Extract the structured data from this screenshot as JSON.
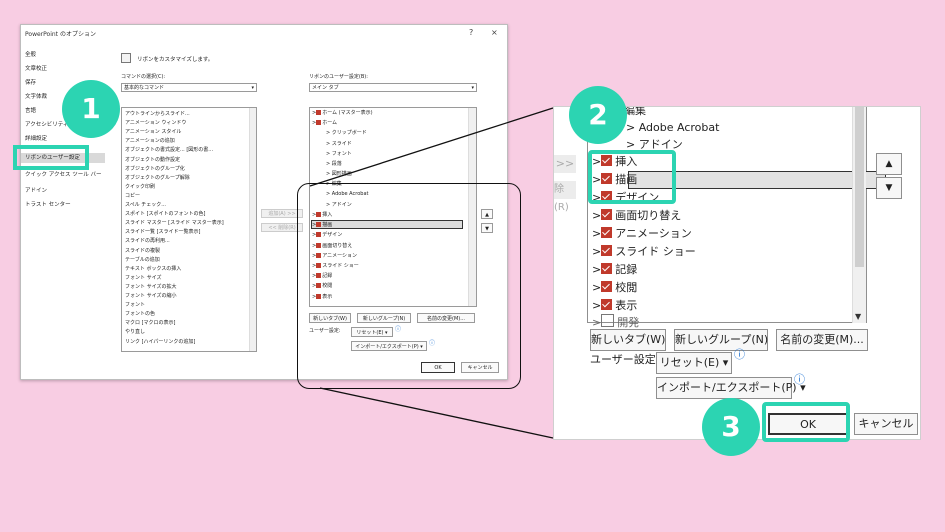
{
  "dialog": {
    "title": "PowerPoint のオプション",
    "help": "?",
    "close": "×",
    "nav": [
      "全般",
      "文章校正",
      "保存",
      "文字体裁",
      "言語",
      "アクセシビリティ",
      "詳細設定",
      "リボンのユーザー設定",
      "クイック アクセス ツール バー",
      "アドイン",
      "トラスト センター"
    ],
    "heading": "リボンをカスタマイズします。",
    "cmd_choose_label": "コマンドの選択(C):",
    "cmd_choose_value": "基本的なコマンド",
    "ribbon_label": "リボンのユーザー設定(B):",
    "ribbon_value": "メイン タブ",
    "commands": [
      "アウトラインからスライド...",
      "アニメーション ウィンドウ",
      "アニメーション スタイル",
      "アニメーションの追加",
      "オブジェクトの書式設定... [図形の書...",
      "オブジェクトの動作設定",
      "オブジェクトのグループ化",
      "オブジェクトのグループ解除",
      "クイック印刷",
      "コピー",
      "スペル チェック...",
      "スポイト [スポイトのフォントの色]",
      "スライド マスター [スライド マスター表示]",
      "スライド一覧 [スライド一覧表示]",
      "スライドの再利用...",
      "スライドの複製",
      "テーブルの追加",
      "テキスト ボックスの挿入",
      "フォント サイズ",
      "フォント サイズの拡大",
      "フォント サイズの縮小",
      "フォント",
      "フォントの色",
      "マクロ [マクロの表示]",
      "やり直し",
      "リンク [ハイパーリンクの追加]"
    ],
    "tabs": [
      "ホーム (マスター表示)",
      "ホーム",
      "クリップボード",
      "スライド",
      "フォント",
      "段落",
      "図形描画",
      "編集",
      "Adobe Acrobat",
      "アドイン",
      "挿入",
      "描画",
      "デザイン",
      "画面切り替え",
      "アニメーション",
      "スライド ショー",
      "記録",
      "校閲",
      "表示"
    ],
    "add_btn": "追加(A) >>",
    "remove_btn": "<< 削除(R)",
    "new_tab": "新しいタブ(W)",
    "new_group": "新しいグループ(N)",
    "rename": "名前の変更(M)...",
    "user_settings": "ユーザー設定:",
    "reset": "リセット(E) ▾",
    "import_export": "インポート/エクスポート(P) ▾",
    "ok": "OK",
    "cancel": "キャンセル"
  },
  "zoom": {
    "partial_top": "編集",
    "acrobat": "Adobe Acrobat",
    "addin": "アドイン",
    "tabs": [
      "挿入",
      "描画",
      "デザイン",
      "画面切り替え",
      "アニメーション",
      "スライド ショー",
      "記録",
      "校閲",
      "表示"
    ],
    "partial_bottom": "開発",
    "add_partial": ">>",
    "remove_partial": "除(R)",
    "new_tab": "新しいタブ(W)",
    "new_group": "新しいグループ(N)",
    "rename": "名前の変更(M)...",
    "user_settings": "ユーザー設定:",
    "reset": "リセット(E) ▾",
    "import_export": "インポート/エクスポート(P) ▾",
    "ok": "OK",
    "cancel": "キャンセル"
  },
  "badges": [
    "1",
    "2",
    "3"
  ],
  "colors": {
    "background": "#f8cde3",
    "accent": "#2cd4b2",
    "check": "#c0392b"
  }
}
